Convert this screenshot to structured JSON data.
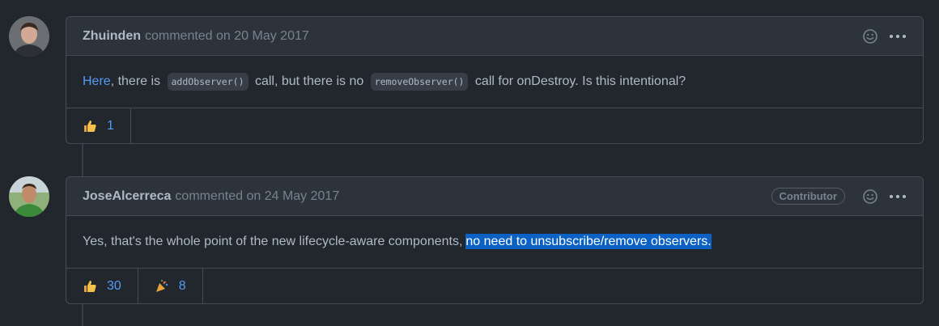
{
  "comments": [
    {
      "author": "Zhuinden",
      "meta": "commented on 20 May 2017",
      "badge": "",
      "body": {
        "link_text": "Here",
        "t1": ", there is ",
        "code1": "addObserver()",
        "t2": " call, but there is no ",
        "code2": "removeObserver()",
        "t3": " call for onDestroy. Is this intentional?"
      },
      "reactions": [
        {
          "emoji": "thumbs-up-icon",
          "count": "1"
        }
      ]
    },
    {
      "author": "JoseAlcerreca",
      "meta": "commented on 24 May 2017",
      "badge": "Contributor",
      "body": {
        "text": "Yes, that's the whole point of the new lifecycle-aware components,",
        "selected": "no need to unsubscribe/remove observers."
      },
      "reactions": [
        {
          "emoji": "thumbs-up-icon",
          "count": "30"
        },
        {
          "emoji": "party-popper-icon",
          "count": "8"
        }
      ]
    }
  ],
  "colors": {
    "background": "#22272e",
    "header": "#2d333b",
    "border": "#444c56",
    "link": "#539bf5",
    "selection": "#0b62c4"
  }
}
